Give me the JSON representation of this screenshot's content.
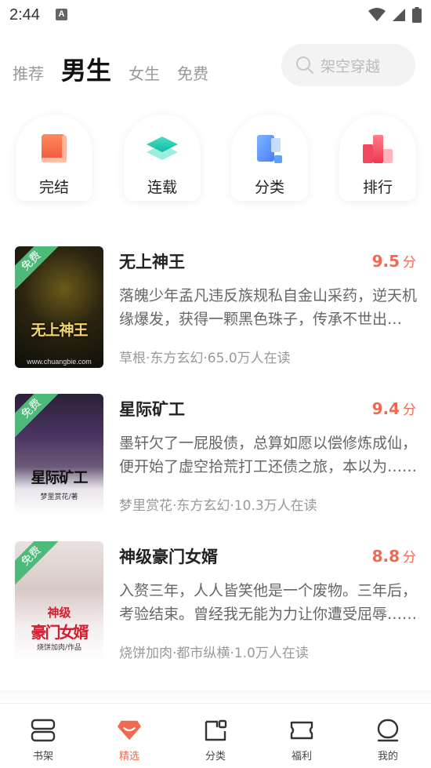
{
  "status": {
    "time": "2:44",
    "notif_glyph": "A"
  },
  "tabs": [
    {
      "label": "推荐"
    },
    {
      "label": "男生"
    },
    {
      "label": "女生"
    },
    {
      "label": "免费"
    }
  ],
  "search": {
    "placeholder": "架空穿越"
  },
  "shortcuts": [
    {
      "label": "完结",
      "icon": "book-icon"
    },
    {
      "label": "连载",
      "icon": "layers-icon"
    },
    {
      "label": "分类",
      "icon": "category-icon"
    },
    {
      "label": "排行",
      "icon": "ranking-icon"
    }
  ],
  "free_badge": "免费",
  "books": [
    {
      "title": "无上神王",
      "score": "9.5",
      "score_unit": "分",
      "desc": "落魄少年孟凡违反族规私自金山采药，逆天机缘爆发，获得一颗黑色珠子，传承不世出的神王传承……",
      "meta": "草根·东方玄幻·65.0万人在读",
      "cover_title": "无上神王",
      "cover_credit": "www.chuangbie.com"
    },
    {
      "title": "星际矿工",
      "score": "9.4",
      "score_unit": "分",
      "desc": "墨轩欠了一屁股债，总算如愿以偿修炼成仙，便开始了虚空拾荒打工还债之旅，本以为……",
      "meta": "梦里赏花·东方玄幻·10.3万人在读",
      "cover_title": "星际矿工",
      "cover_credit": "梦里赏花/著"
    },
    {
      "title": "神级豪门女婿",
      "score": "8.8",
      "score_unit": "分",
      "desc": "入赘三年，人人皆笑他是一个废物。三年后，考验结束。曾经我无能为力让你遭受屈辱……",
      "meta": "烧饼加肉·都市纵横·1.0万人在读",
      "cover_title_top": "神级",
      "cover_title": "豪门女婿",
      "cover_credit": "烧饼加肉/作品"
    }
  ],
  "colors": {
    "accent": "#f06a52",
    "free_badge": "#4cbb7a"
  },
  "nav": [
    {
      "label": "书架",
      "icon": "bookshelf-icon"
    },
    {
      "label": "精选",
      "icon": "diamond-icon",
      "active": true
    },
    {
      "label": "分类",
      "icon": "category-icon"
    },
    {
      "label": "福利",
      "icon": "ticket-icon"
    },
    {
      "label": "我的",
      "icon": "profile-icon"
    }
  ]
}
